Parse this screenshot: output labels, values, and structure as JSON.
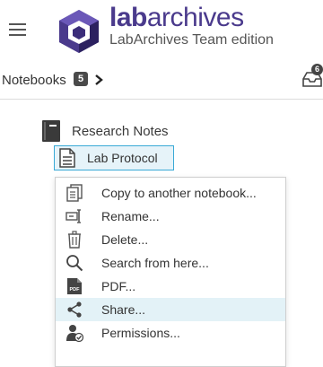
{
  "header": {
    "brand_bold": "lab",
    "brand_light": "archives",
    "edition": "LabArchives Team edition",
    "menu_icon": "hamburger-icon",
    "logo_icon": "labarchives-logo-icon"
  },
  "subbar": {
    "notebooks_label": "Notebooks",
    "notebooks_count": "5",
    "inbox_count": "6",
    "chevron_icon": "chevron-right-icon",
    "inbox_icon": "inbox-icon"
  },
  "tree": {
    "notebook": {
      "label": "Research Notes",
      "icon": "notebook-icon"
    },
    "page": {
      "label": "Lab Protocol",
      "icon": "document-icon",
      "selected": true
    }
  },
  "context_menu": {
    "items": [
      {
        "label": "Copy to another notebook...",
        "icon": "copy-icon"
      },
      {
        "label": "Rename...",
        "icon": "rename-icon"
      },
      {
        "label": "Delete...",
        "icon": "trash-icon"
      },
      {
        "label": "Search from here...",
        "icon": "search-icon"
      },
      {
        "label": "PDF...",
        "icon": "pdf-icon"
      },
      {
        "label": "Share...",
        "icon": "share-icon",
        "highlighted": true
      },
      {
        "label": "Permissions...",
        "icon": "permissions-icon"
      }
    ]
  },
  "colors": {
    "brand": "#4a3a8c",
    "selection_border": "#39a9d6",
    "selection_fill": "#e6f3f9",
    "menu_highlight": "#e3f2f7"
  }
}
